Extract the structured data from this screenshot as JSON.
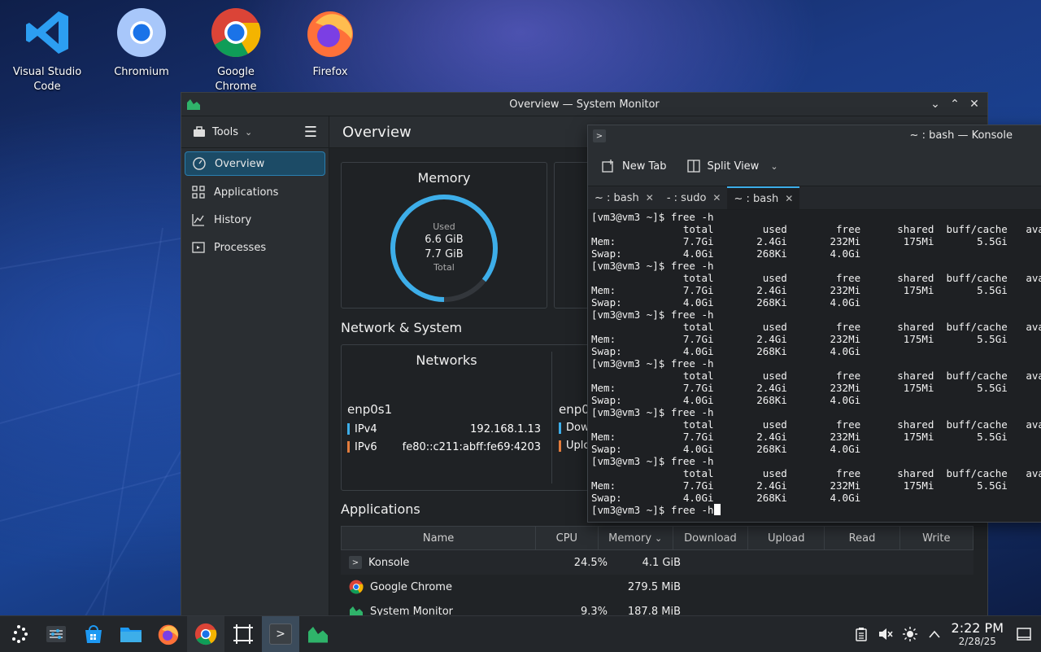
{
  "desktop": {
    "icons": [
      {
        "label": "Visual Studio Code"
      },
      {
        "label": "Chromium"
      },
      {
        "label": "Google Chrome"
      },
      {
        "label": "Firefox"
      }
    ]
  },
  "sysmon": {
    "window_title": "Overview — System Monitor",
    "tools_label": "Tools",
    "header_title": "Overview",
    "nav": [
      {
        "label": "Overview",
        "icon": "speedometer-icon",
        "active": true
      },
      {
        "label": "Applications",
        "icon": "grid-icon"
      },
      {
        "label": "History",
        "icon": "chart-icon"
      },
      {
        "label": "Processes",
        "icon": "window-icon"
      }
    ],
    "memory": {
      "title": "Memory",
      "used_label": "Used",
      "used": "6.6 GiB",
      "total": "7.7 GiB",
      "total_label": "Total",
      "used_fraction": 0.857,
      "accent": "#3daee9"
    },
    "network_section_title": "Network & System",
    "networks": {
      "title": "Networks",
      "interface": "enp0s1",
      "ipv4_label": "IPv4",
      "ipv4": "192.168.1.13",
      "ipv6_label": "IPv6",
      "ipv6": "fe80::c211:abff:fe69:4203",
      "second_interface": "enp0",
      "download_label": "Dow",
      "upload_label": "Uplo",
      "ipv4_color": "#3daee9",
      "ipv6_color": "#e27c3c"
    },
    "applications_title": "Applications",
    "apps_columns": [
      "Name",
      "CPU",
      "Memory",
      "Download",
      "Upload",
      "Read",
      "Write"
    ],
    "apps_rows": [
      {
        "name": "Konsole",
        "cpu": "24.5%",
        "memory": "4.1 GiB",
        "icon": "konsole-icon"
      },
      {
        "name": "Google Chrome",
        "cpu": "",
        "memory": "279.5 MiB",
        "icon": "chrome-icon"
      },
      {
        "name": "System Monitor",
        "cpu": "9.3%",
        "memory": "187.8 MiB",
        "icon": "system-monitor-icon"
      }
    ]
  },
  "konsole": {
    "window_title": "~ : bash — Konsole",
    "new_tab": "New Tab",
    "split_view": "Split View",
    "tabs": [
      {
        "label": "~ : bash"
      },
      {
        "label": "- : sudo"
      },
      {
        "label": "~ : bash",
        "active": true
      }
    ],
    "terminal_text": "[vm3@vm3 ~]$ free -h\n               total        used        free      shared  buff/cache   available\nMem:           7.7Gi       2.4Gi       232Mi       175Mi       5.5Gi\nSwap:          4.0Gi       268Ki       4.0Gi\n[vm3@vm3 ~]$ free -h\n               total        used        free      shared  buff/cache   available\nMem:           7.7Gi       2.4Gi       232Mi       175Mi       5.5Gi\nSwap:          4.0Gi       268Ki       4.0Gi\n[vm3@vm3 ~]$ free -h\n               total        used        free      shared  buff/cache   available\nMem:           7.7Gi       2.4Gi       232Mi       175Mi       5.5Gi\nSwap:          4.0Gi       268Ki       4.0Gi\n[vm3@vm3 ~]$ free -h\n               total        used        free      shared  buff/cache   available\nMem:           7.7Gi       2.4Gi       232Mi       175Mi       5.5Gi\nSwap:          4.0Gi       268Ki       4.0Gi\n[vm3@vm3 ~]$ free -h\n               total        used        free      shared  buff/cache   available\nMem:           7.7Gi       2.4Gi       232Mi       175Mi       5.5Gi\nSwap:          4.0Gi       268Ki       4.0Gi\n[vm3@vm3 ~]$ free -h\n               total        used        free      shared  buff/cache   available\nMem:           7.7Gi       2.4Gi       232Mi       175Mi       5.5Gi\nSwap:          4.0Gi       268Ki       4.0Gi\n[vm3@vm3 ~]$ free -h"
  },
  "taskbar": {
    "items": [
      {
        "icon": "app-launcher-icon"
      },
      {
        "icon": "system-settings-icon"
      },
      {
        "icon": "discover-store-icon"
      },
      {
        "icon": "file-manager-icon"
      },
      {
        "icon": "firefox-icon"
      },
      {
        "icon": "chrome-icon",
        "open": true
      },
      {
        "icon": "spectacle-icon"
      },
      {
        "icon": "konsole-icon",
        "active": true
      },
      {
        "icon": "system-monitor-icon"
      }
    ],
    "time": "2:22 PM",
    "date": "2/28/25"
  }
}
